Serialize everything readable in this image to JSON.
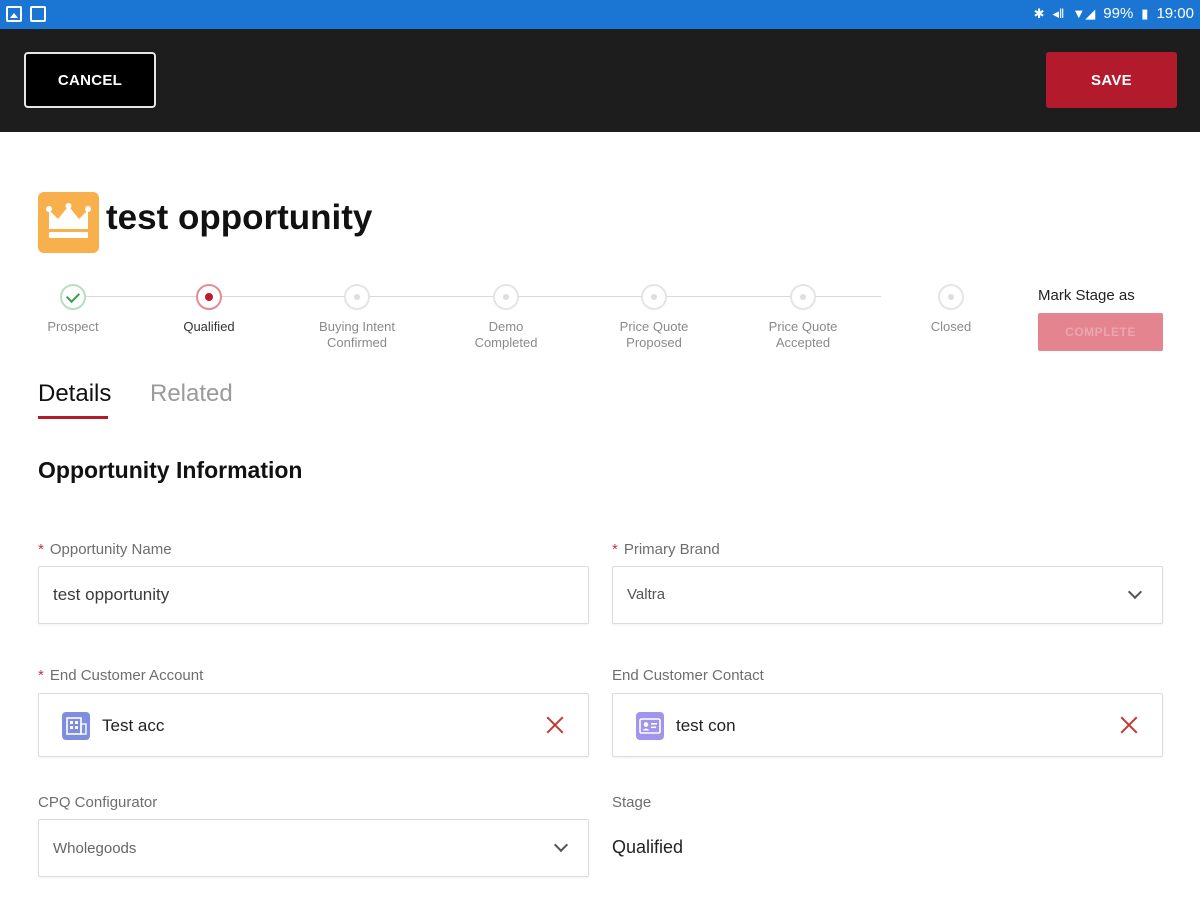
{
  "status_bar": {
    "battery": "99%",
    "time": "19:00"
  },
  "action_bar": {
    "cancel_label": "CANCEL",
    "save_label": "SAVE"
  },
  "record": {
    "title": "test opportunity",
    "icon": "crown-icon",
    "icon_color": "#f7b04c"
  },
  "path": {
    "stages": [
      {
        "label_line1": "Prospect",
        "label_line2": "",
        "state": "complete"
      },
      {
        "label_line1": "Qualified",
        "label_line2": "",
        "state": "current"
      },
      {
        "label_line1": "Buying Intent",
        "label_line2": "Confirmed",
        "state": "pending"
      },
      {
        "label_line1": "Demo",
        "label_line2": "Completed",
        "state": "pending"
      },
      {
        "label_line1": "Price Quote",
        "label_line2": "Proposed",
        "state": "pending"
      },
      {
        "label_line1": "Price Quote",
        "label_line2": "Accepted",
        "state": "pending"
      },
      {
        "label_line1": "Closed",
        "label_line2": "",
        "state": "pending"
      }
    ],
    "mark_stage_label": "Mark Stage as",
    "complete_button_label": "COMPLETE"
  },
  "tabs": {
    "details": "Details",
    "related": "Related"
  },
  "section": {
    "title": "Opportunity Information"
  },
  "fields": {
    "opportunity_name": {
      "label": "Opportunity Name",
      "required": "*",
      "value": "test opportunity"
    },
    "primary_brand": {
      "label": "Primary Brand",
      "required": "*",
      "value": "Valtra"
    },
    "end_customer_account": {
      "label": "End Customer Account",
      "required": "*",
      "value": "Test acc",
      "icon": "account-icon"
    },
    "end_customer_contact": {
      "label": "End Customer Contact",
      "value": "test con",
      "icon": "contact-icon"
    },
    "cpq_configurator": {
      "label": "CPQ Configurator",
      "value": "Wholegoods"
    },
    "stage": {
      "label": "Stage",
      "value": "Qualified"
    }
  },
  "colors": {
    "status_bar": "#1a76d2",
    "action_bar": "#1d1d1d",
    "save_button": "#b31b2c",
    "complete_button": "#e4848e",
    "required_marker": "#c23934",
    "account_icon": "#7f8de1",
    "contact_icon": "#a094ed"
  }
}
